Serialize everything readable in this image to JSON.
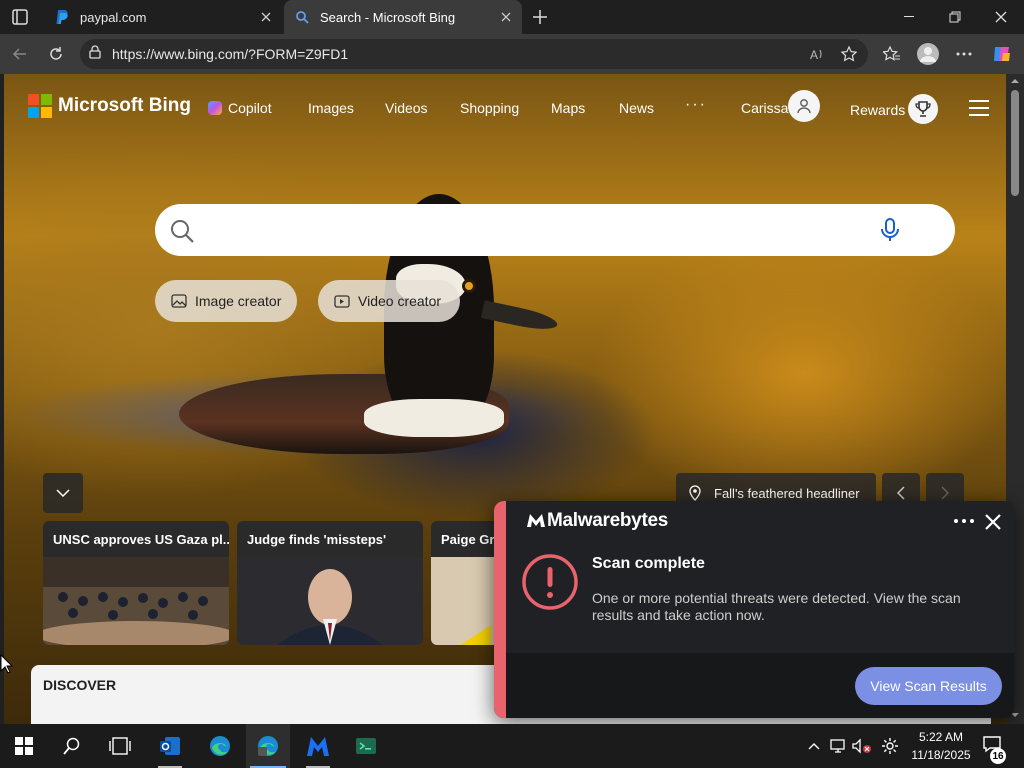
{
  "browser": {
    "tabs": [
      {
        "label": "paypal.com",
        "icon": "paypal-icon",
        "active": false
      },
      {
        "label": "Search - Microsoft Bing",
        "icon": "search-icon",
        "active": true
      }
    ],
    "url": "https://www.bing.com/?FORM=Z9FD1"
  },
  "bing": {
    "brand": "Microsoft Bing",
    "nav": [
      "Copilot",
      "Images",
      "Videos",
      "Shopping",
      "Maps",
      "News",
      "···"
    ],
    "user_name": "Carissa",
    "rewards_label": "Rewards",
    "search_placeholder": "",
    "pills": [
      "Image creator",
      "Video creator"
    ],
    "headliner": "Fall's feathered headliner",
    "news_cards": [
      {
        "title": "UNSC approves US Gaza pl..."
      },
      {
        "title": "Judge finds 'missteps'"
      },
      {
        "title": "Paige Gre"
      }
    ],
    "discover_label": "DISCOVER"
  },
  "malwarebytes": {
    "brand": "Malwarebytes",
    "heading": "Scan complete",
    "message": "One or more potential threats were detected. View the scan results and take action now.",
    "button": "View Scan Results",
    "accent_color": "#e8636b",
    "button_color": "#7b8fe4"
  },
  "taskbar": {
    "time": "5:22 AM",
    "date": "11/18/2025",
    "notification_count": "16"
  }
}
